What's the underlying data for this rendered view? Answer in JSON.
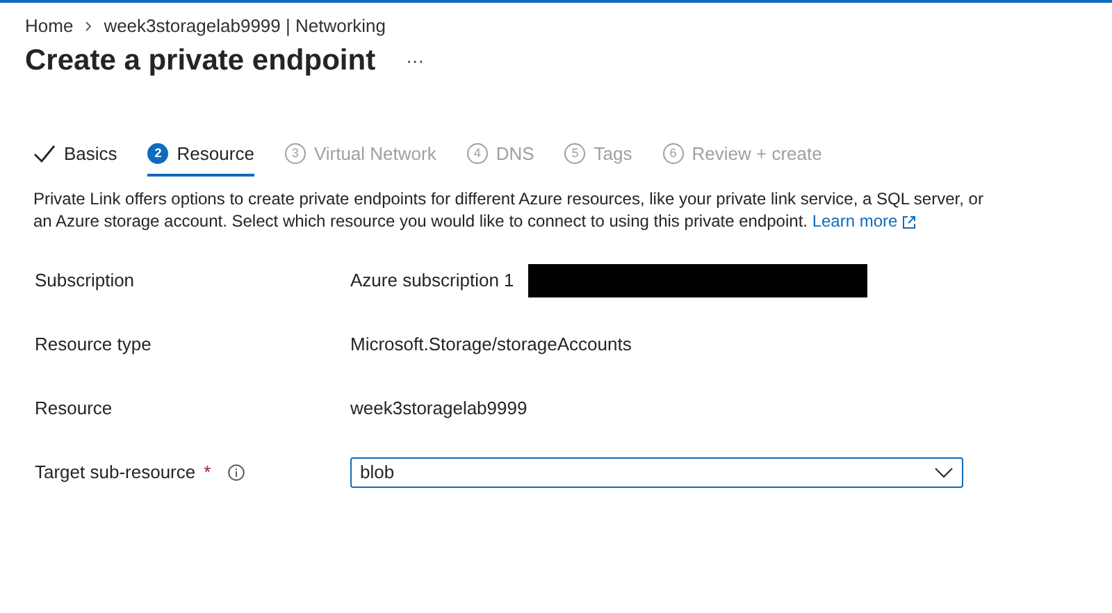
{
  "breadcrumb": [
    {
      "label": "Home"
    },
    {
      "label": "week3storagelab9999 | Networking"
    }
  ],
  "title": "Create a private endpoint",
  "more": "···",
  "tabs": [
    {
      "kind": "done",
      "label": "Basics",
      "selected": false,
      "disabled": false
    },
    {
      "kind": "step",
      "number": "2",
      "label": "Resource",
      "selected": true,
      "disabled": false
    },
    {
      "kind": "step",
      "number": "3",
      "label": "Virtual Network",
      "selected": false,
      "disabled": true
    },
    {
      "kind": "step",
      "number": "4",
      "label": "DNS",
      "selected": false,
      "disabled": true
    },
    {
      "kind": "step",
      "number": "5",
      "label": "Tags",
      "selected": false,
      "disabled": true
    },
    {
      "kind": "step",
      "number": "6",
      "label": "Review + create",
      "selected": false,
      "disabled": true
    }
  ],
  "description": "Private Link offers options to create private endpoints for different Azure resources, like your private link service, a SQL server, or an Azure storage account. Select which resource you would like to connect to using this private endpoint.",
  "learn_more": "Learn more",
  "fields": [
    {
      "kind": "text",
      "label": "Subscription",
      "value": "Azure subscription 1",
      "redacted": true
    },
    {
      "kind": "text",
      "label": "Resource type",
      "value": "Microsoft.Storage/storageAccounts"
    },
    {
      "kind": "text",
      "label": "Resource",
      "value": "week3storagelab9999"
    },
    {
      "kind": "dropdown",
      "label": "Target sub-resource",
      "value": "blob",
      "required_mark": "*",
      "info": true
    }
  ]
}
